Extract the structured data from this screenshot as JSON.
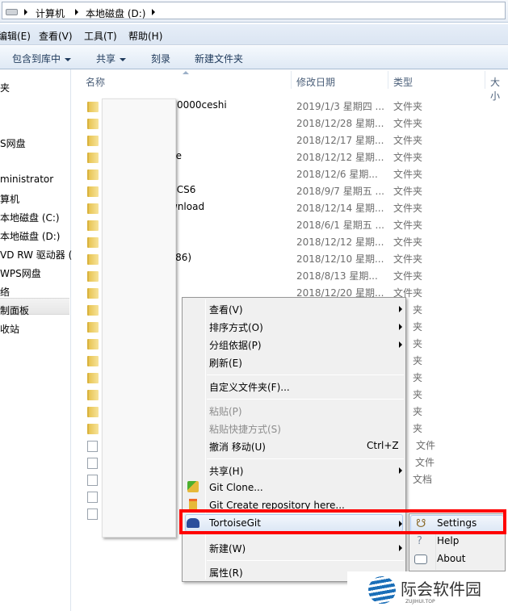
{
  "address": {
    "crumbs": [
      "计算机",
      "本地磁盘 (D:)"
    ]
  },
  "menubar": [
    "编辑(E)",
    "查看(V)",
    "工具(T)",
    "帮助(H)"
  ],
  "toolbar": {
    "include": "包含到库中",
    "share": "共享",
    "burn": "刻录",
    "new_folder": "新建文件夹"
  },
  "sidebar": [
    "夹",
    "S网盘",
    "ministrator",
    "算机",
    "本地磁盘 (C:)",
    "本地磁盘 (D:)",
    "VD RW 驱动器 (",
    "WPS网盘",
    "络",
    "制面板",
    "收站"
  ],
  "columns": {
    "name": "名称",
    "date": "修改日期",
    "type": "类型",
    "size": "大小"
  },
  "files": [
    {
      "name": "0000ceshi",
      "date": "2019/1/3 星期四 ...",
      "type": "文件夹"
    },
    {
      "name": "",
      "date": "2018/12/28 星期...",
      "type": "文件夹"
    },
    {
      "name": "",
      "date": "2018/12/17 星期...",
      "type": "文件夹"
    },
    {
      "name": "ne",
      "date": "2018/12/12 星期...",
      "type": "文件夹"
    },
    {
      "name": "",
      "date": "2018/12/6 星期...",
      "type": "文件夹"
    },
    {
      "name": "r CS6",
      "date": "2018/9/7 星期五 ...",
      "type": "文件夹"
    },
    {
      "name": "wnload",
      "date": "2018/12/14 星期...",
      "type": "文件夹"
    },
    {
      "name": "",
      "date": "2018/6/1 星期五 ...",
      "type": "文件夹"
    },
    {
      "name": "",
      "date": "2018/12/12 星期...",
      "type": "文件夹"
    },
    {
      "name": "x86)",
      "date": "2018/12/10 星期...",
      "type": "文件夹"
    },
    {
      "name": "",
      "date": "2018/8/13 星期...",
      "type": "文件夹"
    },
    {
      "name": "y",
      "date": "2018/12/20 星期...",
      "type": "文件夹"
    }
  ],
  "hidden_types": [
    "夹",
    "夹",
    "夹",
    "夹",
    "夹",
    "夹",
    "夹",
    "夹",
    "文件",
    "文件",
    "文档"
  ],
  "context_menu": {
    "view": "查看(V)",
    "sort": "排序方式(O)",
    "group": "分组依据(P)",
    "refresh": "刷新(E)",
    "customize": "自定义文件夹(F)...",
    "paste": "粘贴(P)",
    "paste_shortcut": "粘贴快捷方式(S)",
    "undo": "撤消 移动(U)",
    "undo_shortcut": "Ctrl+Z",
    "share": "共享(H)",
    "git_clone": "Git Clone...",
    "git_create": "Git Create repository here...",
    "tortoisegit": "TortoiseGit",
    "new": "新建(W)",
    "properties": "属性(R)"
  },
  "submenu": {
    "settings": "Settings",
    "help": "Help",
    "about": "About"
  },
  "watermark": {
    "name": "际会软件园",
    "url": "ZUJIHUI.TOP"
  },
  "colors": {
    "highlight": "#ff0000",
    "menu_bg": "#f0f0f0"
  }
}
